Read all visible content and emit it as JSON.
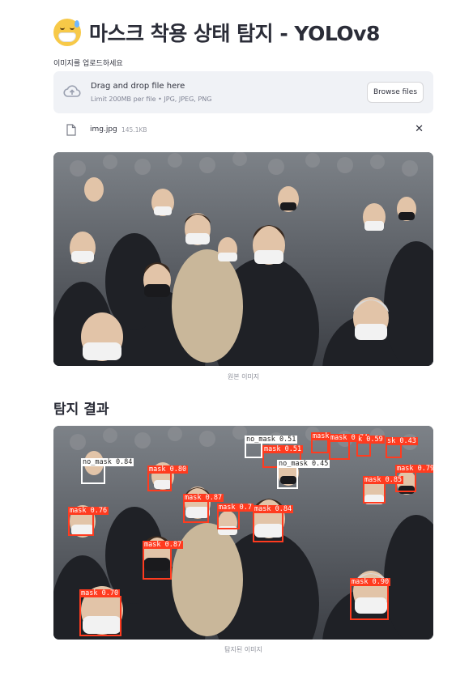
{
  "header": {
    "title": "마스크 착용 상태 탐지 - YOLOv8",
    "emoji": "face-with-mask-sweat-emoji"
  },
  "uploader": {
    "label": "이미지를 업로드하세요",
    "drop_title": "Drag and drop file here",
    "drop_sub": "Limit 200MB per file • JPG, JPEG, PNG",
    "browse_label": "Browse files",
    "file": {
      "name": "img.jpg",
      "size": "145.1KB"
    }
  },
  "original": {
    "caption": "원본 이미지"
  },
  "results": {
    "heading": "탐지 결과",
    "caption": "탐지된 이미지",
    "detections": [
      {
        "label": "no_mask 0.51"
      },
      {
        "label": "mask 0.51"
      },
      {
        "label": "mask"
      },
      {
        "label": "mask 0.74"
      },
      {
        "label": "k 0.59"
      },
      {
        "label": "sk 0.43"
      },
      {
        "label": "no_mask 0.84"
      },
      {
        "label": "mask 0.80"
      },
      {
        "label": "no_mask 0.45"
      },
      {
        "label": "mask 0.79"
      },
      {
        "label": "mask 0.85"
      },
      {
        "label": "mask 0.87"
      },
      {
        "label": "mask 0.7"
      },
      {
        "label": "mask 0.84"
      },
      {
        "label": "mask 0.76"
      },
      {
        "label": "mask 0.87"
      },
      {
        "label": "mask 0.70"
      },
      {
        "label": "mask 0.90"
      }
    ]
  },
  "colors": {
    "mask_box": "#ff3b1f",
    "no_mask_box": "#ffffff",
    "dropzone_bg": "#f0f2f6"
  }
}
